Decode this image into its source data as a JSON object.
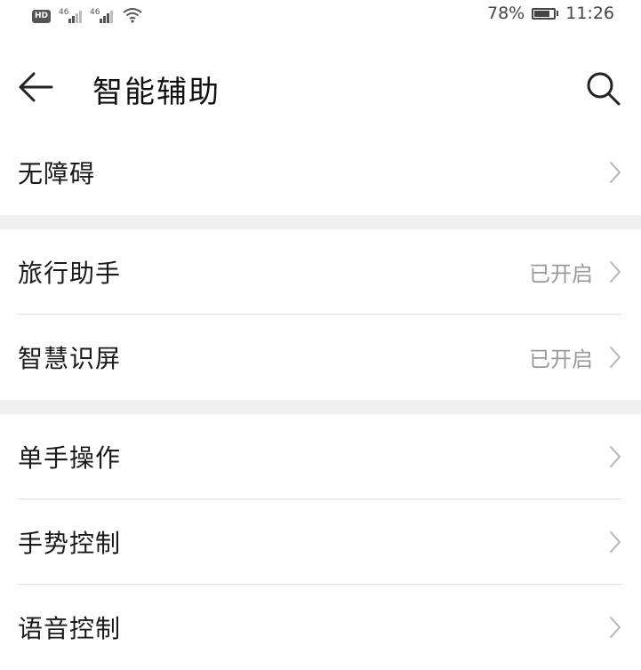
{
  "status_bar": {
    "hd": "HD",
    "sig1_label": "46",
    "sig2_label": "46",
    "battery": "78%",
    "battery_fill": 0.78,
    "time": "11:26"
  },
  "header": {
    "title": "智能辅助",
    "back_icon": "arrow-left-icon",
    "search_icon": "search-icon"
  },
  "groups": [
    {
      "items": [
        {
          "label": "无障碍",
          "status": ""
        }
      ]
    },
    {
      "items": [
        {
          "label": "旅行助手",
          "status": "已开启"
        },
        {
          "label": "智慧识屏",
          "status": "已开启"
        }
      ]
    },
    {
      "items": [
        {
          "label": "单手操作",
          "status": ""
        },
        {
          "label": "手势控制",
          "status": ""
        },
        {
          "label": "语音控制",
          "status": ""
        }
      ]
    }
  ],
  "colors": {
    "text": "#1a1a1a",
    "secondary": "#9a9a9a",
    "divider": "#e2e2e2",
    "group_gap": "#f0f0f0"
  }
}
